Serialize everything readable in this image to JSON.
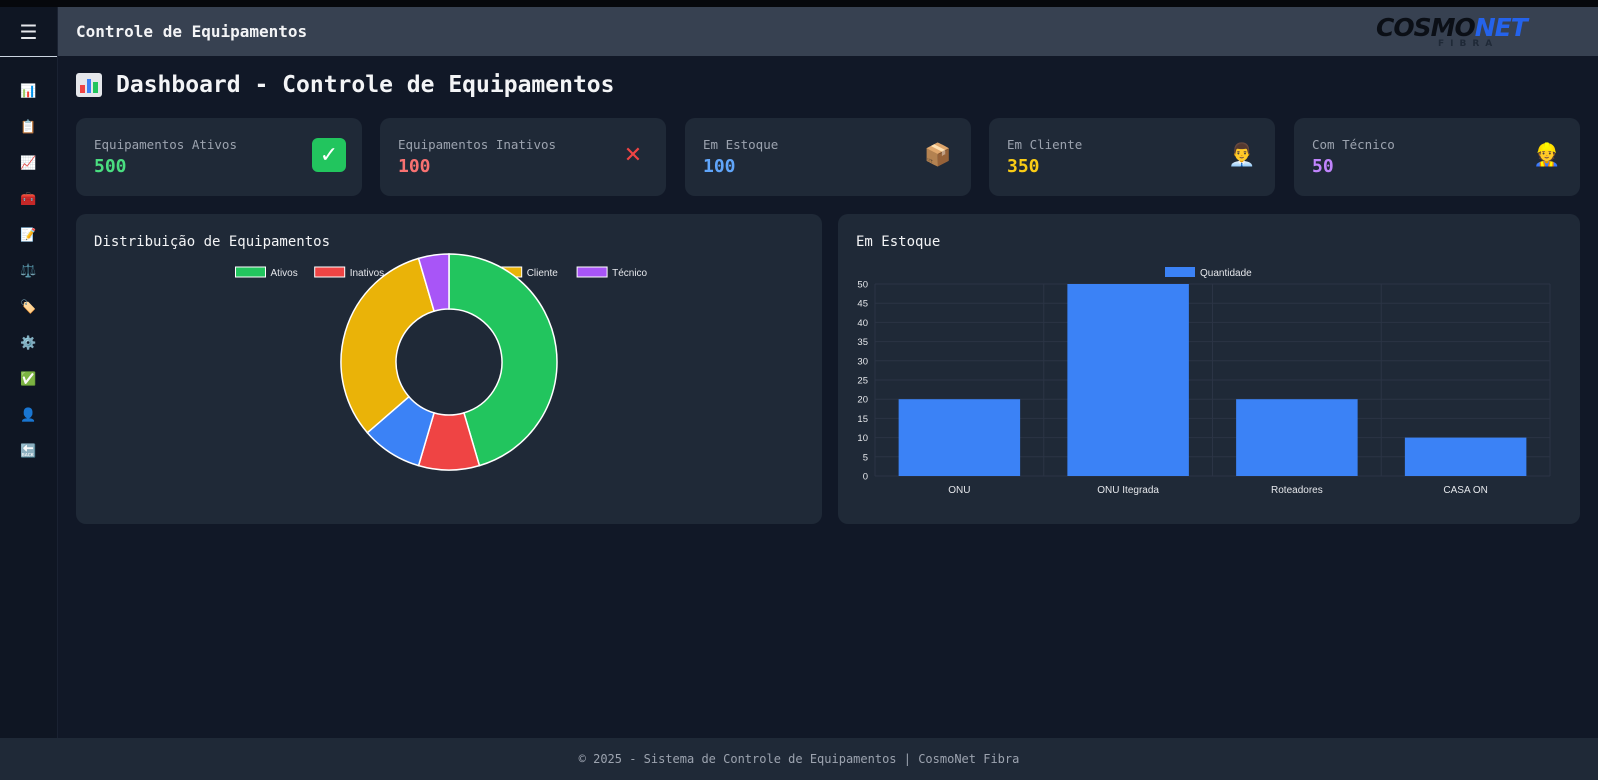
{
  "app": {
    "title": "Controle de Equipamentos",
    "logo": {
      "main_a": "COSMO",
      "main_b": "NET",
      "sub": "FIBRA"
    }
  },
  "sidebar": {
    "menu_icon": "hamburger-icon",
    "items": [
      {
        "icon": "bar-chart-icon",
        "glyph": "📊"
      },
      {
        "icon": "clipboard-icon",
        "glyph": "📋"
      },
      {
        "icon": "chart-increasing-icon",
        "glyph": "📈"
      },
      {
        "icon": "toolbox-icon",
        "glyph": "🧰"
      },
      {
        "icon": "memo-icon",
        "glyph": "📝"
      },
      {
        "icon": "balance-scale-icon",
        "glyph": "⚖️"
      },
      {
        "icon": "label-tag-icon",
        "glyph": "🏷️"
      },
      {
        "icon": "gear-icon",
        "glyph": "⚙️"
      },
      {
        "icon": "check-mark-icon",
        "glyph": "✅"
      },
      {
        "icon": "user-icon",
        "glyph": "👤"
      },
      {
        "icon": "back-arrow-icon",
        "glyph": "🔙"
      }
    ]
  },
  "page": {
    "heading": "Dashboard - Controle de Equipamentos",
    "heading_icon": "bar-chart-icon"
  },
  "cards": [
    {
      "label": "Equipamentos Ativos",
      "value": "500",
      "color": "#4ade80",
      "icon": "check-mark-icon",
      "glyph": "✓",
      "icon_bg": "#22c55e",
      "icon_fg": "#ffffff"
    },
    {
      "label": "Equipamentos Inativos",
      "value": "100",
      "color": "#f87171",
      "icon": "cross-mark-icon",
      "glyph": "✕",
      "icon_bg": "transparent",
      "icon_fg": "#ef4444"
    },
    {
      "label": "Em Estoque",
      "value": "100",
      "color": "#60a5fa",
      "icon": "package-icon",
      "glyph": "📦",
      "icon_bg": "transparent",
      "icon_fg": "#c08a4a"
    },
    {
      "label": "Em Cliente",
      "value": "350",
      "color": "#facc15",
      "icon": "office-worker-icon",
      "glyph": "👨‍💼",
      "icon_bg": "transparent",
      "icon_fg": "#e5e7eb"
    },
    {
      "label": "Com Técnico",
      "value": "50",
      "color": "#c084fc",
      "icon": "construction-worker-icon",
      "glyph": "👷",
      "icon_bg": "transparent",
      "icon_fg": "#eab308"
    }
  ],
  "panels": {
    "distribution_title": "Distribuição de Equipamentos",
    "stock_title": "Em Estoque"
  },
  "chart_data": [
    {
      "type": "pie",
      "title": "Distribuição de Equipamentos",
      "hole": true,
      "categories": [
        "Ativos",
        "Inativos",
        "Estoque",
        "Cliente",
        "Técnico"
      ],
      "values": [
        500,
        100,
        100,
        350,
        50
      ],
      "colors": [
        "#22c55e",
        "#ef4444",
        "#3b82f6",
        "#eab308",
        "#a855f7"
      ],
      "legend": "top"
    },
    {
      "type": "bar",
      "title": "Em Estoque",
      "categories": [
        "ONU",
        "ONU Itegrada",
        "Roteadores",
        "CASA ON"
      ],
      "series": [
        {
          "name": "Quantidade",
          "values": [
            20,
            50,
            20,
            10
          ],
          "color": "#3b82f6"
        }
      ],
      "yticks": [
        0,
        5,
        10,
        15,
        20,
        25,
        30,
        35,
        40,
        45,
        50
      ],
      "ylim": [
        0,
        50
      ],
      "grid": true,
      "legend": "top"
    }
  ],
  "footer": {
    "text": "© 2025 - Sistema de Controle de Equipamentos | CosmoNet Fibra"
  }
}
